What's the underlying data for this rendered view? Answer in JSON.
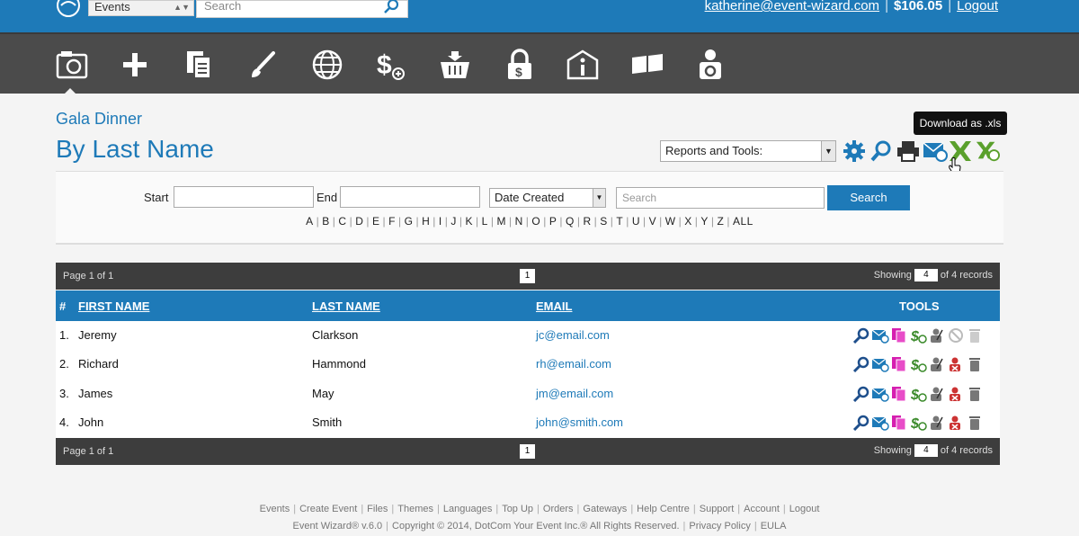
{
  "header": {
    "event_select": "Events",
    "search_placeholder": "Search",
    "user_email": "katherine@event-wizard.com",
    "balance": "$106.05",
    "logout": "Logout"
  },
  "toolbar_icons": [
    "events-icon",
    "plus-icon",
    "copy-icon",
    "brush-icon",
    "globe-icon",
    "dollar-icon",
    "basket-icon",
    "lock-icon",
    "info-icon",
    "flag-icon",
    "user-settings-icon"
  ],
  "event_name": "Gala Dinner",
  "page_title": "By Last Name",
  "reports_select": "Reports and Tools:",
  "tooltip": "Download as .xls",
  "filter": {
    "start_label": "Start",
    "end_label": "End",
    "date_type": "Date Created",
    "search_placeholder": "Search",
    "search_button": "Search",
    "letters": [
      "A",
      "B",
      "C",
      "D",
      "E",
      "F",
      "G",
      "H",
      "I",
      "J",
      "K",
      "L",
      "M",
      "N",
      "O",
      "P",
      "Q",
      "R",
      "S",
      "T",
      "U",
      "V",
      "W",
      "X",
      "Y",
      "Z",
      "ALL"
    ]
  },
  "pager": {
    "page_label": "Page 1 of 1",
    "page_number": "1",
    "showing": "Showing",
    "count": "4",
    "of_records": "of 4 records"
  },
  "table": {
    "headers": {
      "num": "#",
      "first": "FIRST NAME",
      "last": "LAST NAME",
      "email": "EMAIL",
      "tools": "TOOLS"
    },
    "rows": [
      {
        "num": "1.",
        "first": "Jeremy",
        "last": "Clarkson",
        "email": "jc@email.com"
      },
      {
        "num": "2.",
        "first": "Richard",
        "last": "Hammond",
        "email": "rh@email.com"
      },
      {
        "num": "3.",
        "first": "James",
        "last": "May",
        "email": "jm@email.com"
      },
      {
        "num": "4.",
        "first": "John",
        "last": "Smith",
        "email": "john@smith.com"
      }
    ]
  },
  "footer": {
    "links": [
      "Events",
      "Create Event",
      "Files",
      "Themes",
      "Languages",
      "Top Up",
      "Orders",
      "Gateways",
      "Help Centre",
      "Support",
      "Account",
      "Logout"
    ],
    "copyright": "Event Wizard® v.6.0",
    "copyright2": "Copyright © 2014, DotCom Your Event Inc.® All Rights Reserved.",
    "privacy": "Privacy Policy",
    "eula": "EULA"
  },
  "colors": {
    "brand": "#1e7ab8",
    "toolbar": "#4b4b4b",
    "pager": "#3d3d3d"
  }
}
